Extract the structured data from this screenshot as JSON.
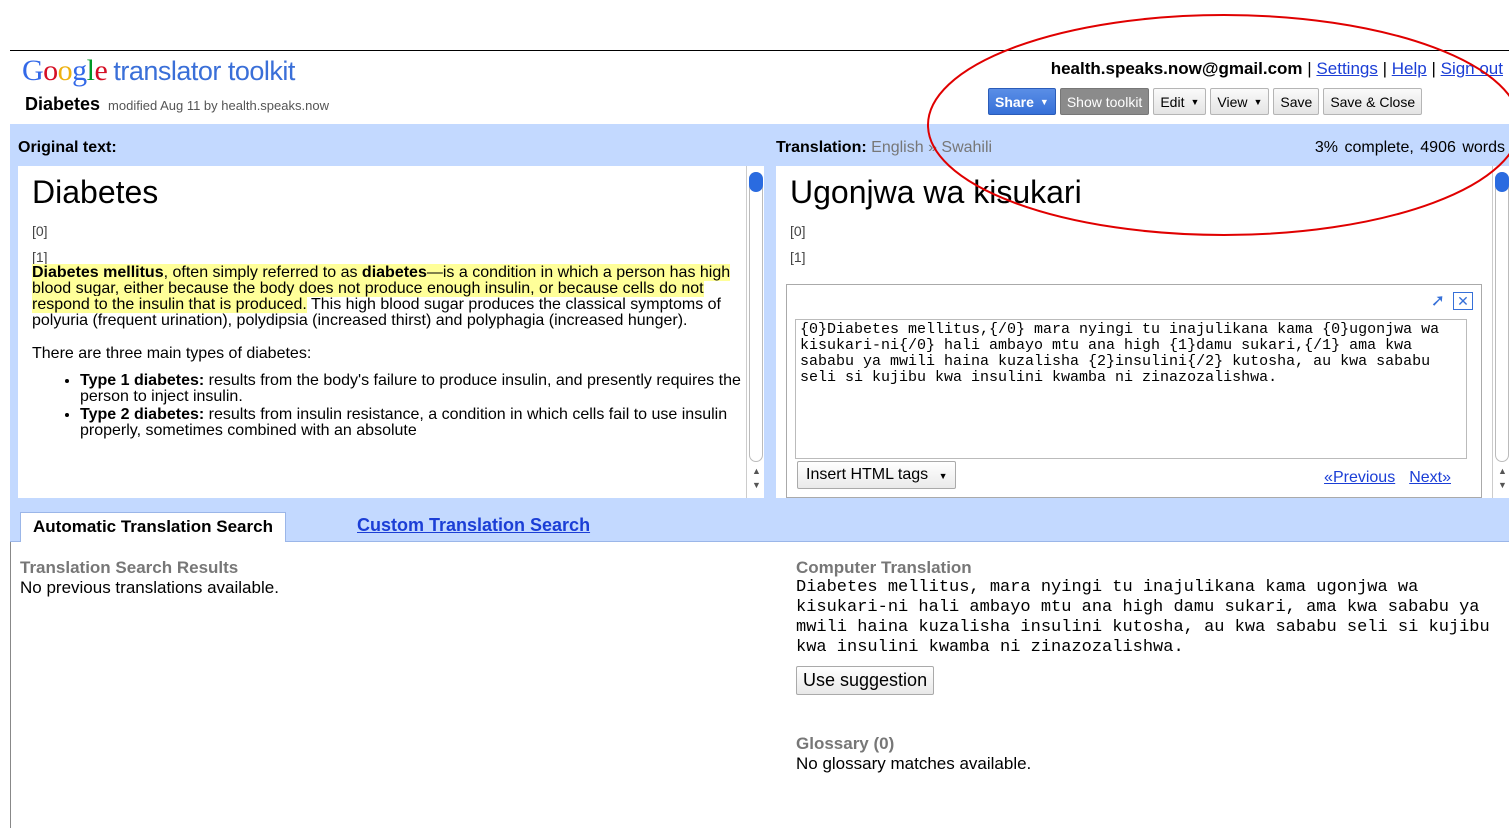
{
  "header": {
    "logo_google": "Google",
    "logo_sub": "translator toolkit",
    "doc_title": "Diabetes",
    "doc_modified": "modified Aug 11 by health.speaks.now",
    "account_email": "health.speaks.now@gmail.com",
    "sep": "|",
    "settings_link": "Settings",
    "help_link": "Help",
    "signout_link": "Sign out"
  },
  "toolbar": {
    "share": "Share",
    "show_toolkit": "Show toolkit",
    "edit": "Edit",
    "view": "View",
    "save": "Save",
    "save_close": "Save & Close"
  },
  "original": {
    "label": "Original text:",
    "heading": "Diabetes",
    "seg0": "[0]",
    "seg1": "[1]",
    "p1_b1": "Diabetes mellitus",
    "p1_t1": ", often simply referred to as ",
    "p1_b2": "diabetes",
    "p1_t2": "—is a condition in which a person has high blood sugar, either because the body does not produce enough insulin, or because cells do not respond to the insulin that is produced.",
    "p1_t3": " This high blood sugar produces the classical symptoms of polyuria (frequent urination), polydipsia (increased thirst) and polyphagia (increased hunger).",
    "p2": "There are three main types of diabetes:",
    "li1_b": "Type 1 diabetes:",
    "li1_t": " results from the body's failure to produce insulin, and presently requires the person to inject insulin.",
    "li2_b": "Type 2 diabetes:",
    "li2_t": " results from insulin resistance, a condition in which cells fail to use insulin properly, sometimes combined with an absolute"
  },
  "translation": {
    "label": "Translation:",
    "langs": "English » Swahili",
    "progress": "3% complete,",
    "words": "4906 words",
    "heading": "Ugonjwa wa kisukari",
    "seg0": "[0]",
    "seg1": "[1]",
    "edit_text": "{0}Diabetes mellitus,{/0} mara nyingi tu inajulikana kama {0}ugonjwa wa kisukari-ni{/0} hali ambayo mtu ana high {1}damu sukari,{/1} ama kwa sababu ya mwili haina kuzalisha {2}insulini{/2} kutosha, au kwa sababu seli si kujibu kwa insulini kwamba ni zinazozalishwa.",
    "insert_html": "Insert HTML tags",
    "previous": "«Previous",
    "next": "Next»"
  },
  "bottom": {
    "tab_auto": "Automatic Translation Search",
    "tab_custom": "Custom Translation Search",
    "tsr_title": "Translation Search Results",
    "tsr_text": "No previous translations available.",
    "ct_title": "Computer Translation",
    "ct_text": "Diabetes mellitus, mara nyingi tu inajulikana kama ugonjwa wa kisukari-ni hali ambayo mtu ana high damu sukari, ama kwa sababu ya mwili haina kuzalisha insulini kutosha, au kwa sababu seli si kujibu kwa insulini kwamba ni zinazozalishwa.",
    "use_suggestion": "Use suggestion",
    "glossary_title": "Glossary (0)",
    "glossary_text": "No glossary matches available."
  },
  "colors": {
    "panel_blue": "#c3d9ff",
    "link_blue": "#1b3ed6",
    "highlight": "#ffff99",
    "annotation_red": "#e00000"
  }
}
